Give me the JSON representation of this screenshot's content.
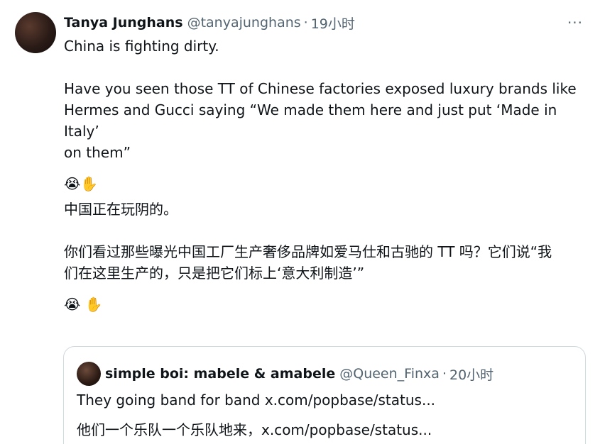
{
  "tweet": {
    "author_name": "Tanya Junghans",
    "author_handle": "@tanyajunghans",
    "separator": "·",
    "time": "19小时",
    "more_icon": "···",
    "text_lines": {
      "l1": "China is fighting dirty.",
      "l2": "Have you seen those TT of Chinese factories exposed luxury brands like",
      "l3": "Hermes and Gucci saying “We made them here and just put ‘Made in Italy’",
      "l4": "on them”",
      "emoji1": "😭✋",
      "z1": "中国正在玩阴的。",
      "z2": "你们看过那些曝光中国工厂生产奢侈品牌如爱马仕和古驰的 TT 吗？它们说“我",
      "z3": "们在这里生产的，只是把它们标上‘意大利制造’”",
      "emoji2": "😭 ✋"
    }
  },
  "quote": {
    "author_name": "simple boi: mabele & amabele",
    "author_handle": "@Queen_Finxa",
    "separator": "·",
    "time": "20小时",
    "line1": "They going band for band x.com/popbase/status...",
    "line2": "他们一个乐队一个乐队地来，x.com/popbase/status..."
  }
}
